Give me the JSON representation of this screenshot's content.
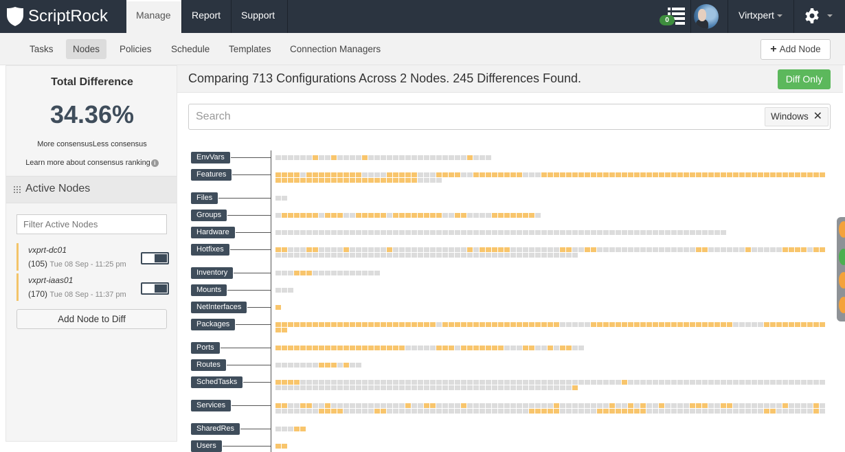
{
  "brand": {
    "name": "ScriptRock"
  },
  "topnav": {
    "tabs": [
      "Manage",
      "Report",
      "Support"
    ],
    "notifications": "0",
    "user": "Virtxpert"
  },
  "subnav": {
    "tabs": [
      "Tasks",
      "Nodes",
      "Policies",
      "Schedule",
      "Templates",
      "Connection Managers"
    ],
    "add_node": "Add Node"
  },
  "summary": {
    "title": "Total Difference",
    "value": "34.36%",
    "scale": "More consensusLess consensus",
    "learn": "Learn more about consensus ranking"
  },
  "active_nodes": {
    "title": "Active Nodes",
    "filter_placeholder": "Filter Active Nodes",
    "nodes": [
      {
        "name": "vxprt-dc01",
        "count": "(105)",
        "time": "Tue 08 Sep - 11:25 pm"
      },
      {
        "name": "vxprt-iaas01",
        "count": "(170)",
        "time": "Tue 08 Sep - 11:37 pm"
      }
    ],
    "add_button": "Add Node to Diff"
  },
  "comparison": {
    "heading": "Comparing 713 Configurations Across 2 Nodes. 245 Differences Found.",
    "diff_only": "Diff Only",
    "search_placeholder": "Search",
    "filter_tag": "Windows",
    "categories": [
      {
        "name": "EnvVars",
        "pattern": "ggggggoggoggggoggggggggggggggggoggg"
      },
      {
        "name": "Features",
        "pattern": "oooogoooooooooggggooooogggooooggoooooooogggooooooooooooooooooooooooooooooooooooooooooooooooooooooooooooooooooooogggg"
      },
      {
        "name": "Files",
        "pattern": "gg"
      },
      {
        "name": "Groups",
        "pattern": "goooooogoooggooooogooooooooggooggggooooooog"
      },
      {
        "name": "Hardware",
        "pattern": "ggggggggggggggggggggggggggggggggggggggggggggggggggggggggggggggggggggggggg"
      },
      {
        "name": "Hotfixes",
        "pattern": "oogggooggggoggggggoggggggggggggogoooooggggggggooggooggggggggggggggggooggggggogggggoooogoooooggggggggggggggggggggggggggggggggggggggggggggggggggggggggggggggggggggggggggggggggggggooooggggggggogog",
        "pattern2": "ggggggggggggggggggggggggggggggggggggggggggggggggg"
      },
      {
        "name": "Inventory",
        "pattern": "gggoooggggggggggg"
      },
      {
        "name": "Mounts",
        "pattern": "ggg"
      },
      {
        "name": "NetInterfaces",
        "pattern": "o"
      },
      {
        "name": "Packages",
        "pattern": "oooooooooooooooooooooooooogooooooooooooooooooogggggooooooooooooooooooooooogggggoooooooooooo"
      },
      {
        "name": "Ports",
        "pattern": "ooooooooooooooooooooogggggooogooooooogggooggogoogg"
      },
      {
        "name": "Routes",
        "pattern": "gggggggooogogg"
      },
      {
        "name": "SchedTasks",
        "pattern": "ooooggggggggggggggggggggggggggggggggggggggggggggggggggggoggggggggggggggggggggggggggggggggggggggggggggggggggggggggggggggggggggggggggggggggo"
      },
      {
        "name": "Services",
        "pattern": "ooggooggoggggggggggggoggooggggoggggggggggggggoggggggggoggogoggoggggoooggooggggggggoggggoggggggoggggggooogggggggggggggoggggggooggg",
        "pattern2": "gggggggoooogggggoogggggggggggggggggggggggoooooggggggoooooooogggggggggggggggggggooggggggoggggggggggggggoooggggggg"
      },
      {
        "name": "SharedRes",
        "pattern": "gggoo"
      },
      {
        "name": "Users",
        "pattern": "oo"
      }
    ]
  },
  "colors": {
    "navbar": "#2b3440",
    "label": "#3f4d5b",
    "diff": "#f8c56c",
    "same": "#dcdcdc",
    "diff_only": "#5cb85c",
    "node_accent": "#f3c469"
  }
}
